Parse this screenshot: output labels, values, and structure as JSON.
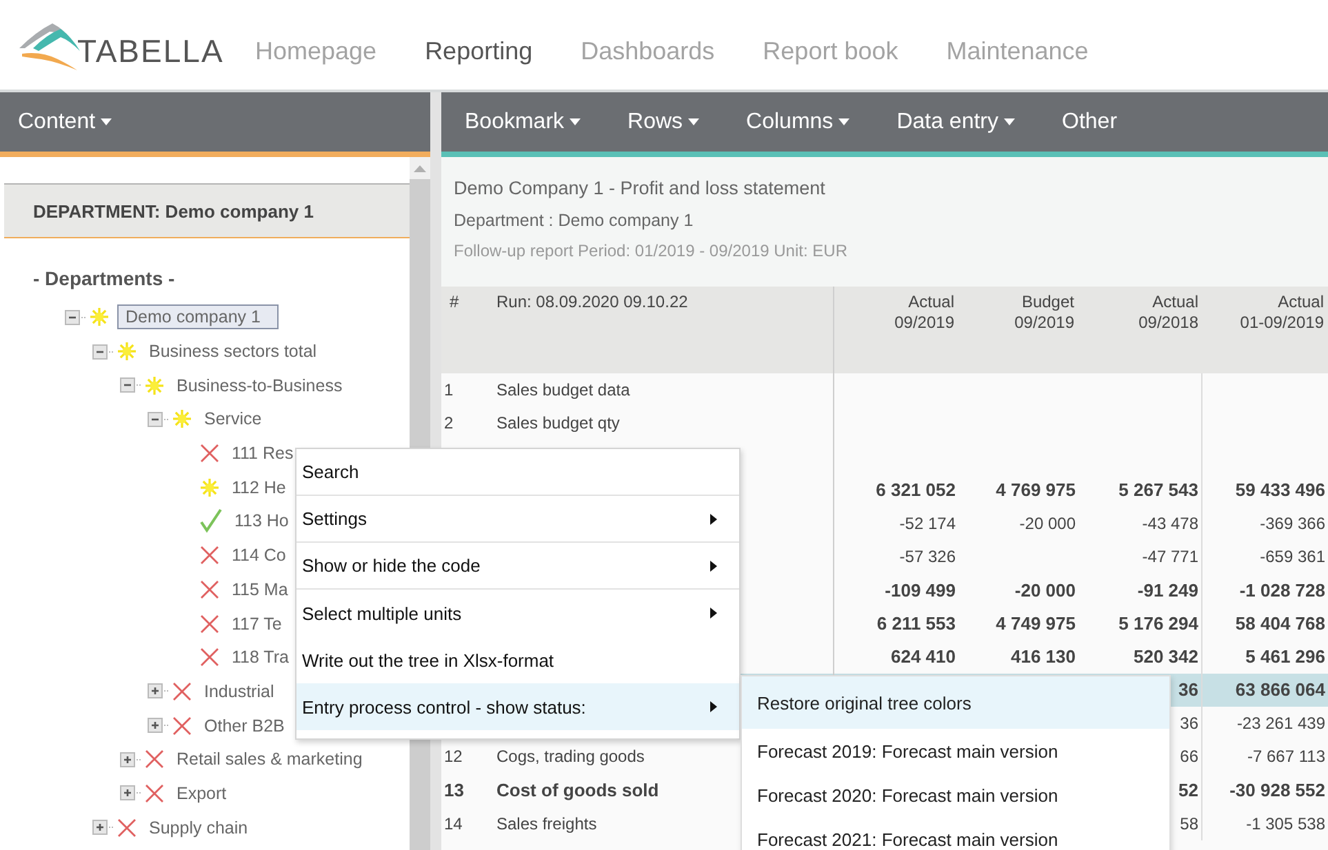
{
  "brand": "TABELLA",
  "nav": [
    {
      "label": "Homepage",
      "selected": false
    },
    {
      "label": "Reporting",
      "selected": true
    },
    {
      "label": "Dashboards",
      "selected": false
    },
    {
      "label": "Report book",
      "selected": false
    },
    {
      "label": "Maintenance",
      "selected": false
    }
  ],
  "left_toolbar": [
    {
      "label": "Content",
      "has_caret": true
    }
  ],
  "right_toolbar": [
    {
      "label": "Bookmark",
      "has_caret": true
    },
    {
      "label": "Rows",
      "has_caret": true
    },
    {
      "label": "Columns",
      "has_caret": true
    },
    {
      "label": "Data entry",
      "has_caret": true
    },
    {
      "label": "Other",
      "has_caret": false
    }
  ],
  "department_header": "DEPARTMENT: Demo company 1",
  "tree": {
    "heading": "- Departments -",
    "items": [
      {
        "label": "Demo company 1",
        "kind": "sun",
        "expanded": true,
        "selected": true,
        "children": [
          {
            "label": "Business sectors total",
            "kind": "sun",
            "expanded": true,
            "selected": false,
            "children": [
              {
                "label": "Business-to-Business",
                "kind": "sun",
                "expanded": true,
                "selected": false,
                "children": [
                  {
                    "label": "Service",
                    "kind": "sun",
                    "expanded": true,
                    "selected": false,
                    "children": [
                      {
                        "label": "111 Res",
                        "kind": "cross",
                        "selected": false
                      },
                      {
                        "label": "112 He",
                        "kind": "sun",
                        "selected": false
                      },
                      {
                        "label": "113 Ho",
                        "kind": "check",
                        "selected": false
                      },
                      {
                        "label": "114 Co",
                        "kind": "cross",
                        "selected": false
                      },
                      {
                        "label": "115 Ma",
                        "kind": "cross",
                        "selected": false
                      },
                      {
                        "label": "117 Te",
                        "kind": "cross",
                        "selected": false
                      },
                      {
                        "label": "118 Tra",
                        "kind": "cross",
                        "selected": false
                      }
                    ]
                  },
                  {
                    "label": "Industrial",
                    "kind": "cross",
                    "expanded": false,
                    "selected": false
                  },
                  {
                    "label": "Other B2B",
                    "kind": "cross",
                    "expanded": false,
                    "selected": false
                  }
                ]
              },
              {
                "label": "Retail sales & marketing",
                "kind": "cross",
                "expanded": false,
                "selected": false
              },
              {
                "label": "Export",
                "kind": "cross",
                "expanded": false,
                "selected": false
              }
            ]
          },
          {
            "label": "Supply chain",
            "kind": "cross",
            "expanded": false,
            "selected": false
          }
        ]
      }
    ]
  },
  "report": {
    "title": "Demo Company 1 - Profit and loss statement",
    "department": "Department : Demo company 1",
    "subtitle": "Follow-up report Period: 01/2019 - 09/2019 Unit: EUR"
  },
  "table": {
    "columns": [
      {
        "lines": [
          "#"
        ]
      },
      {
        "lines": [
          "Run: 08.09.2020 09.10.22"
        ]
      },
      {
        "lines": [
          "Actual",
          "09/2019"
        ]
      },
      {
        "lines": [
          "Budget",
          "09/2019"
        ]
      },
      {
        "lines": [
          "Actual",
          "09/2018"
        ]
      },
      {
        "lines": [
          "Actual",
          "01-09/2019"
        ]
      }
    ],
    "rows": [
      {
        "number": "1",
        "label": "Sales budget data",
        "bold": false,
        "highlighted": false
      },
      {
        "number": "2",
        "label": "Sales budget qty",
        "bold": false,
        "highlighted": false
      },
      {
        "highlighted": false
      },
      {
        "values": {
          "column_3": "6 321 052",
          "column_4": "4 769 975",
          "column_5": "5 267 543",
          "column_6": "59 433 496"
        },
        "bold": true,
        "highlighted": false
      },
      {
        "values": {
          "column_3": "-52 174",
          "column_4": "-20 000",
          "column_5": "-43 478",
          "column_6": "-369 366"
        },
        "bold": false,
        "highlighted": false
      },
      {
        "values": {
          "column_3": "-57 326",
          "column_5": "-47 771",
          "column_6": "-659 361"
        },
        "bold": false,
        "highlighted": false
      },
      {
        "values": {
          "column_3": "-109 499",
          "column_4": "-20 000",
          "column_5": "-91 249",
          "column_6": "-1 028 728"
        },
        "bold": true,
        "highlighted": false
      },
      {
        "values": {
          "column_3": "6 211 553",
          "column_4": "4 749 975",
          "column_5": "5 176 294",
          "column_6": "58 404 768"
        },
        "bold": true,
        "highlighted": false
      },
      {
        "values": {
          "column_3": "624 410",
          "column_4": "416 130",
          "column_5": "520 342",
          "column_6": "5 461 296"
        },
        "bold": true,
        "highlighted": false
      },
      {
        "values": {
          "column_5": "36",
          "column_6": "63 866 064"
        },
        "bold": true,
        "highlighted": true
      },
      {
        "values": {
          "column_5": "36",
          "column_6": "-23 261 439"
        },
        "bold": false,
        "highlighted": false
      },
      {
        "number": "12",
        "label": "Cogs, trading goods",
        "values": {
          "column_5": "66",
          "column_6": "-7 667 113"
        },
        "bold": false,
        "highlighted": false
      },
      {
        "number": "13",
        "label": "Cost of goods sold",
        "values": {
          "column_5": "52",
          "column_6": "-30 928 552"
        },
        "bold": true,
        "highlighted": false
      },
      {
        "number": "14",
        "label": "Sales freights",
        "values": {
          "column_5": "58",
          "column_6": "-1 305 538"
        },
        "bold": false,
        "highlighted": false
      }
    ]
  },
  "context_menu": [
    {
      "label": "Search",
      "has_submenu": false,
      "separator_after": true,
      "selected": false
    },
    {
      "label": "Settings",
      "has_submenu": true,
      "separator_after": true,
      "selected": false
    },
    {
      "label": "Show or hide the code",
      "has_submenu": true,
      "separator_after": true,
      "selected": false
    },
    {
      "label": "Select multiple units",
      "has_submenu": true,
      "separator_after": false,
      "selected": false
    },
    {
      "label": "Write out the tree in Xlsx-format",
      "has_submenu": false,
      "separator_after": false,
      "selected": false
    },
    {
      "label": "Entry process control - show status:",
      "has_submenu": true,
      "separator_after": false,
      "selected": true
    }
  ],
  "submenu": [
    {
      "label": "Restore original tree colors",
      "selected": true
    },
    {
      "label": "Forecast 2019: Forecast main version",
      "selected": false
    },
    {
      "label": "Forecast 2020: Forecast main version",
      "selected": false
    },
    {
      "label": "Forecast 2021: Forecast main version",
      "selected": false
    }
  ]
}
